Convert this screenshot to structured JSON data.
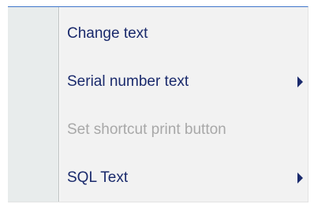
{
  "context_menu": {
    "items": [
      {
        "label": "Change text",
        "enabled": true,
        "has_submenu": false,
        "submenu_icon": ""
      },
      {
        "label": "Serial number text",
        "enabled": true,
        "has_submenu": true,
        "submenu_icon": "triangle-right-icon"
      },
      {
        "label": "Set shortcut print button",
        "enabled": false,
        "has_submenu": false,
        "submenu_icon": ""
      },
      {
        "label": "SQL Text",
        "enabled": true,
        "has_submenu": true,
        "submenu_icon": "triangle-right-icon"
      }
    ],
    "colors": {
      "text": "#1a2a6c",
      "disabled_text": "#a8a8a8",
      "accent_border": "#3f76c9",
      "gutter": "#e8ecec",
      "background": "#f2f2f2"
    }
  }
}
